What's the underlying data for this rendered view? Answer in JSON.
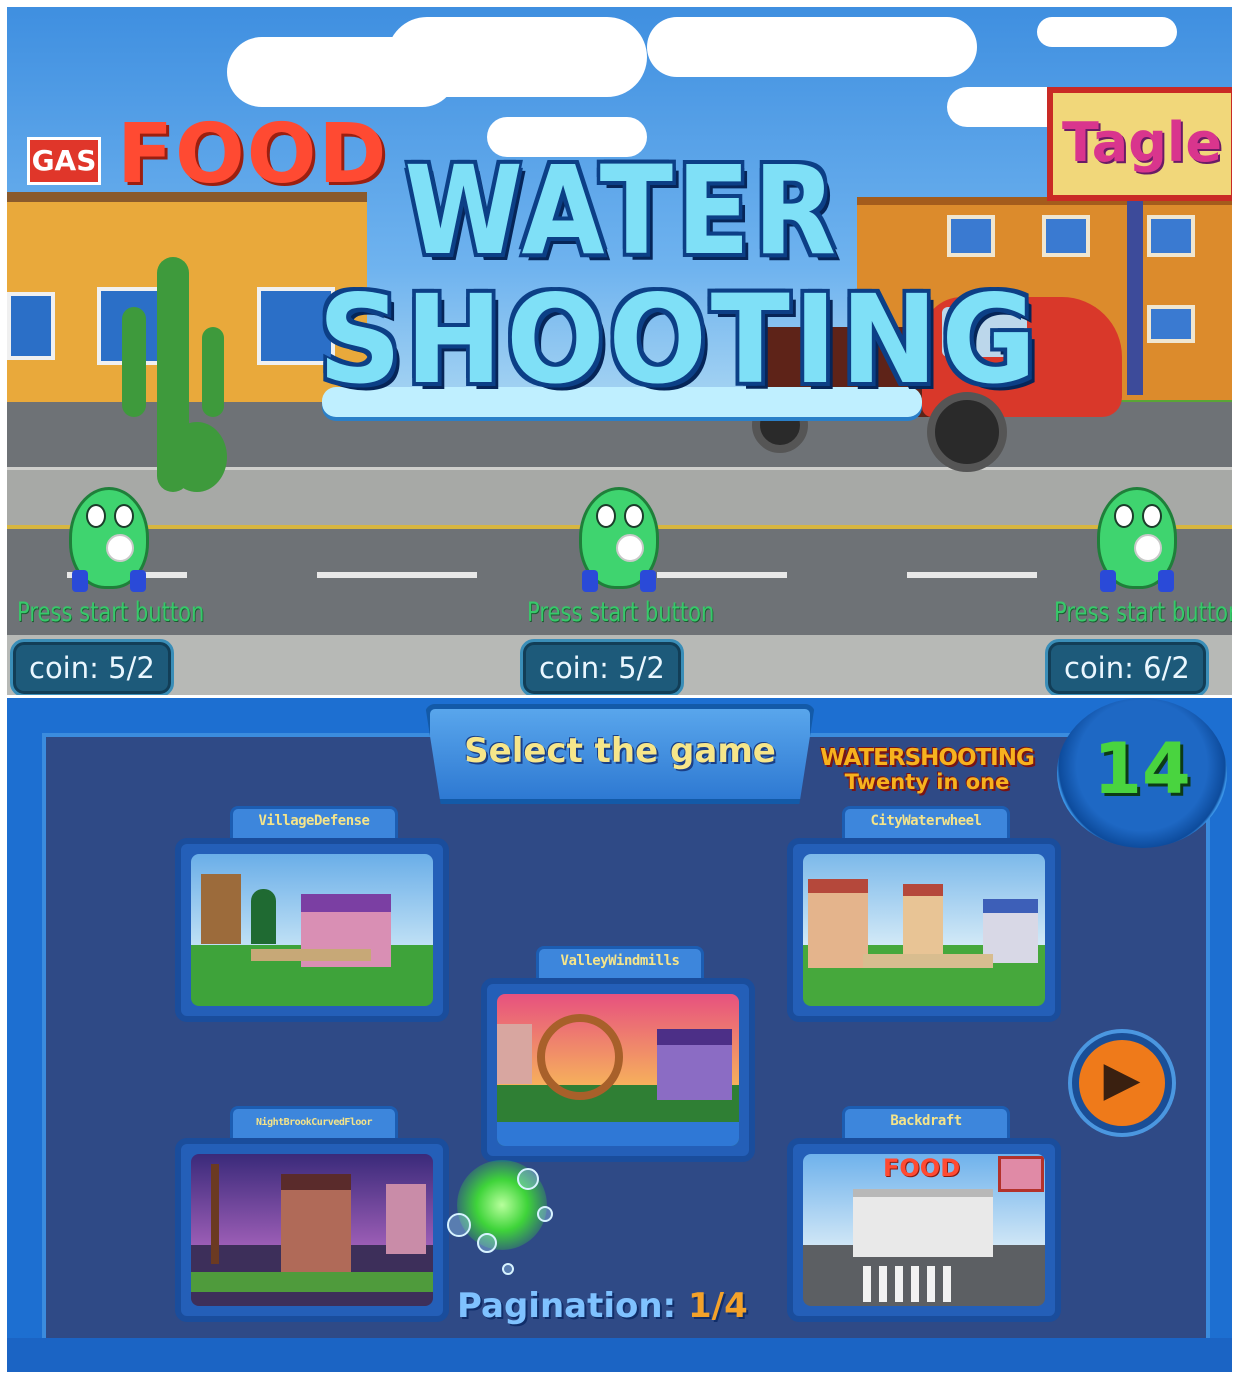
{
  "top_screen": {
    "logo": {
      "line1": "WATER",
      "line2": "SHOOTING"
    },
    "signs": {
      "food": "FOOD",
      "gas": "GAS",
      "brand": "Tagle"
    },
    "players": [
      {
        "prompt": "Press start button",
        "coin_label": "coin:",
        "coin_value": "5/2"
      },
      {
        "prompt": "Press start button",
        "coin_label": "coin:",
        "coin_value": "5/2"
      },
      {
        "prompt": "Press start button",
        "coin_label": "coin:",
        "coin_value": "6/2"
      }
    ]
  },
  "bottom_screen": {
    "title": "Select the game",
    "brand_line1": "WATERSHOOTING",
    "brand_line2": "Twenty in one",
    "game_count": "14",
    "games": [
      {
        "label": "VillageDefense"
      },
      {
        "label": "CityWaterwheel"
      },
      {
        "label": "ValleyWindmills"
      },
      {
        "label": "NightBrookCurvedFloor"
      },
      {
        "label": "Backdraft",
        "sign": "FOOD"
      }
    ],
    "pagination_label": "Pagination:",
    "pagination_value": "1/4"
  },
  "colors": {
    "frame_blue": "#1d6fd1",
    "board_navy": "#2f4a86",
    "accent_orange": "#ef7a1a",
    "counter_green": "#49d43f",
    "prompt_green": "#37c86a"
  },
  "icons": [
    "next-arrow-icon",
    "mascot-icon",
    "cursor-splash-icon"
  ]
}
